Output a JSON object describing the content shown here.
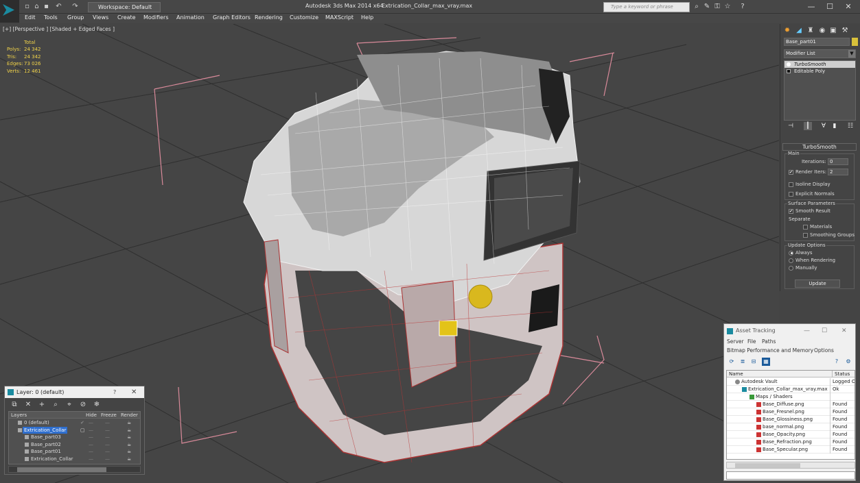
{
  "titlebar": {
    "workspace": "Workspace: Default",
    "app_title": "Autodesk 3ds Max  2014 x64",
    "file_title": "Extrication_Collar_max_vray.max",
    "search_placeholder": "Type a keyword or phrase"
  },
  "menubar": [
    "Edit",
    "Tools",
    "Group",
    "Views",
    "Create",
    "Modifiers",
    "Animation",
    "Graph Editors",
    "Rendering",
    "Customize",
    "MAXScript",
    "Help"
  ],
  "viewport": {
    "label": "[+] [Perspective ] [Shaded + Edged Faces ]",
    "stats": {
      "header": "Total",
      "rows": [
        {
          "key": "Polys:",
          "value": "24 342"
        },
        {
          "key": "Tris:",
          "value": "24 342"
        },
        {
          "key": "Edges:",
          "value": "73 026"
        },
        {
          "key": "Verts:",
          "value": "12 461"
        }
      ]
    }
  },
  "command_panel": {
    "object_name": "Base_part01",
    "object_color": "#d8c13a",
    "modifier_list": "Modifier List",
    "stack": [
      "TurboSmooth",
      "Editable Poly"
    ],
    "turbosmooth": {
      "title": "TurboSmooth",
      "main_label": "Main",
      "iterations_label": "Iterations:",
      "iterations_value": "0",
      "render_iters_label": "Render Iters:",
      "render_iters_value": "2",
      "isoline": "Isoline Display",
      "explicit": "Explicit Normals",
      "surface_label": "Surface Parameters",
      "smooth_result": "Smooth Result",
      "separate_label": "Separate",
      "materials": "Materials",
      "smoothing_groups": "Smoothing Groups",
      "update_options_label": "Update Options",
      "always": "Always",
      "when_rendering": "When Rendering",
      "manually": "Manually",
      "update_button": "Update"
    }
  },
  "layer_window": {
    "title": "Layer: 0 (default)",
    "help": "?",
    "columns": {
      "layers": "Layers",
      "hide": "Hide",
      "freeze": "Freeze",
      "render": "Render"
    },
    "rows": [
      {
        "name": "0 (default)",
        "level": 1
      },
      {
        "name": "Extrication_Collar",
        "level": 1
      },
      {
        "name": "Base_part03",
        "level": 2
      },
      {
        "name": "Base_part02",
        "level": 2
      },
      {
        "name": "Base_part01",
        "level": 2
      },
      {
        "name": "Extrication_Collar",
        "level": 2
      }
    ]
  },
  "asset_tracking": {
    "title": "Asset Tracking",
    "menu1": [
      "Server",
      "File",
      "Paths"
    ],
    "menu2": [
      "Bitmap Performance and Memory",
      "Options"
    ],
    "columns": {
      "name": "Name",
      "status": "Status"
    },
    "rows": [
      {
        "name": "Autodesk Vault",
        "status": "Logged O",
        "level": 0
      },
      {
        "name": "Extrication_Collar_max_vray.max",
        "status": "Ok",
        "level": 1
      },
      {
        "name": "Maps / Shaders",
        "status": "",
        "level": 2
      },
      {
        "name": "Base_Diffuse.png",
        "status": "Found",
        "level": 3
      },
      {
        "name": "Base_Fresnel.png",
        "status": "Found",
        "level": 3
      },
      {
        "name": "Base_Glossiness.png",
        "status": "Found",
        "level": 3
      },
      {
        "name": "base_normal.png",
        "status": "Found",
        "level": 3
      },
      {
        "name": "Base_Opacity.png",
        "status": "Found",
        "level": 3
      },
      {
        "name": "Base_Refraction.png",
        "status": "Found",
        "level": 3
      },
      {
        "name": "Base_Specular.png",
        "status": "Found",
        "level": 3
      }
    ]
  }
}
